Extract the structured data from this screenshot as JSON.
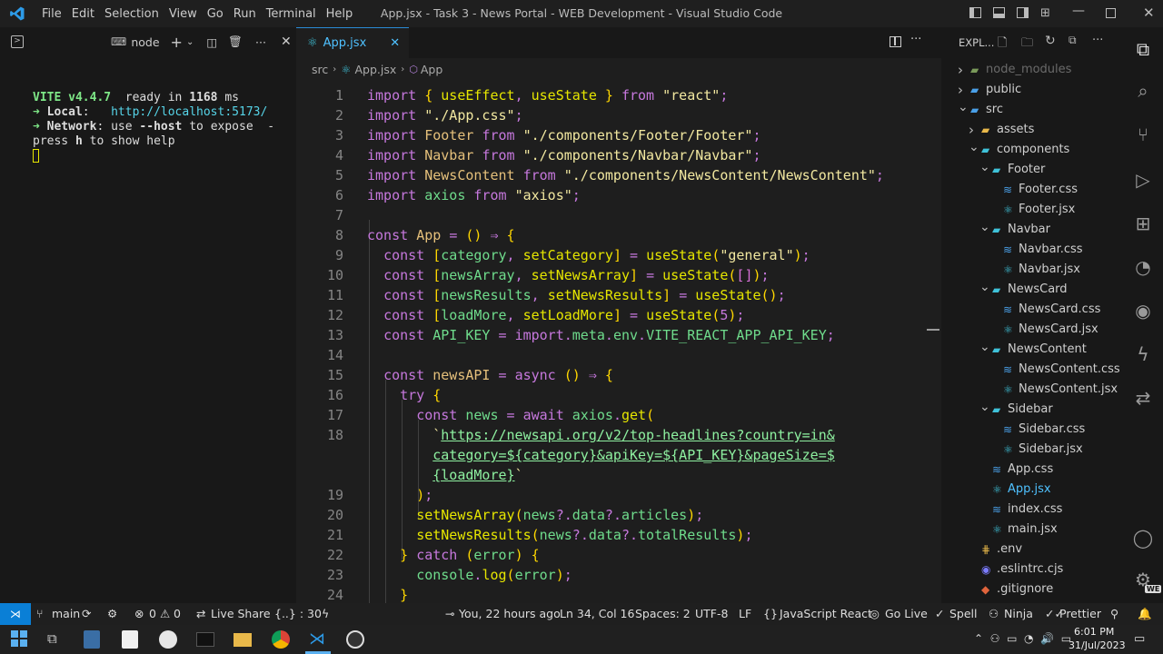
{
  "titlebar": {
    "menu": [
      "File",
      "Edit",
      "Selection",
      "View",
      "Go",
      "Run",
      "Terminal",
      "Help"
    ],
    "title": "App.jsx - Task 3 - News Portal - WEB Development - Visual Studio Code"
  },
  "terminal": {
    "tab_label": "node",
    "lines": [
      "VITE v4.4.7  ready in 1168 ms",
      "",
      "➜ Local:   http://localhost:5173/",
      "➜ Network: use --host to expose  -",
      "press h to show help"
    ]
  },
  "editor": {
    "tab": "App.jsx",
    "breadcrumb": [
      "src",
      "App.jsx",
      "App"
    ],
    "line_numbers": [
      "1",
      "2",
      "3",
      "4",
      "5",
      "6",
      "7",
      "8",
      "9",
      "10",
      "11",
      "12",
      "13",
      "14",
      "15",
      "16",
      "17",
      "18",
      "",
      "",
      "19",
      "20",
      "21",
      "22",
      "23",
      "24"
    ],
    "code": [
      "import { useEffect, useState } from \"react\";",
      "import \"./App.css\";",
      "import Footer from \"./components/Footer/Footer\";",
      "import Navbar from \"./components/Navbar/Navbar\";",
      "import NewsContent from \"./components/NewsContent/NewsContent\";",
      "import axios from \"axios\";",
      "",
      "const App = () ⇒ {",
      "  const [category, setCategory] = useState(\"general\");",
      "  const [newsArray, setNewsArray] = useState([]);",
      "  const [newsResults, setNewsResults] = useState();",
      "  const [loadMore, setLoadMore] = useState(5);",
      "  const API_KEY = import.meta.env.VITE_REACT_APP_API_KEY;",
      "",
      "  const newsAPI = async () ⇒ {",
      "    try {",
      "      const news = await axios.get(",
      "        `https://newsapi.org/v2/top-headlines?country=in&",
      "        category=${category}&apiKey=${API_KEY}&pageSize=$",
      "        {loadMore}`",
      "      );",
      "      setNewsArray(news?.data?.articles);",
      "      setNewsResults(news?.data?.totalResults);",
      "    } catch (error) {",
      "      console.log(error);",
      "    }"
    ]
  },
  "explorer": {
    "header": "EXPL...",
    "items": [
      {
        "label": "node_modules",
        "level": 0,
        "type": "folder",
        "open": false,
        "dim": true
      },
      {
        "label": "public",
        "level": 0,
        "type": "folder",
        "open": false
      },
      {
        "label": "src",
        "level": 0,
        "type": "folder",
        "open": true
      },
      {
        "label": "assets",
        "level": 1,
        "type": "folder",
        "open": false
      },
      {
        "label": "components",
        "level": 1,
        "type": "folder",
        "open": true
      },
      {
        "label": "Footer",
        "level": 2,
        "type": "folder",
        "open": true
      },
      {
        "label": "Footer.css",
        "level": 3,
        "type": "css"
      },
      {
        "label": "Footer.jsx",
        "level": 3,
        "type": "jsx"
      },
      {
        "label": "Navbar",
        "level": 2,
        "type": "folder",
        "open": true
      },
      {
        "label": "Navbar.css",
        "level": 3,
        "type": "css"
      },
      {
        "label": "Navbar.jsx",
        "level": 3,
        "type": "jsx"
      },
      {
        "label": "NewsCard",
        "level": 2,
        "type": "folder",
        "open": true
      },
      {
        "label": "NewsCard.css",
        "level": 3,
        "type": "css"
      },
      {
        "label": "NewsCard.jsx",
        "level": 3,
        "type": "jsx"
      },
      {
        "label": "NewsContent",
        "level": 2,
        "type": "folder",
        "open": true
      },
      {
        "label": "NewsContent.css",
        "level": 3,
        "type": "css"
      },
      {
        "label": "NewsContent.jsx",
        "level": 3,
        "type": "jsx"
      },
      {
        "label": "Sidebar",
        "level": 2,
        "type": "folder",
        "open": true
      },
      {
        "label": "Sidebar.css",
        "level": 3,
        "type": "css"
      },
      {
        "label": "Sidebar.jsx",
        "level": 3,
        "type": "jsx"
      },
      {
        "label": "App.css",
        "level": 2,
        "type": "css"
      },
      {
        "label": "App.jsx",
        "level": 2,
        "type": "jsx",
        "active": true
      },
      {
        "label": "index.css",
        "level": 2,
        "type": "css"
      },
      {
        "label": "main.jsx",
        "level": 2,
        "type": "jsx"
      },
      {
        "label": ".env",
        "level": 1,
        "type": "env"
      },
      {
        "label": ".eslintrc.cjs",
        "level": 1,
        "type": "eslint"
      },
      {
        "label": ".gitignore",
        "level": 1,
        "type": "git"
      }
    ]
  },
  "status": {
    "branch": "main",
    "errors": "0",
    "warnings": "0",
    "live_share": "Live Share",
    "braces": "{..} : 30",
    "blame": "You, 22 hours ago",
    "position": "Ln 34, Col 16",
    "spaces": "Spaces: 2",
    "encoding": "UTF-8",
    "eol": "LF",
    "language": "JavaScript React",
    "go_live": "Go Live",
    "spell": "Spell",
    "ninja": "Ninja",
    "prettier": "Prettier"
  },
  "taskbar": {
    "time": "6:01 PM",
    "date": "31/Jul/2023"
  },
  "colors": {
    "accent": "#0a7fd6",
    "jsx_icon": "#3fc1d8",
    "css_icon": "#4aa0e8",
    "folder": "#dcb67a"
  }
}
